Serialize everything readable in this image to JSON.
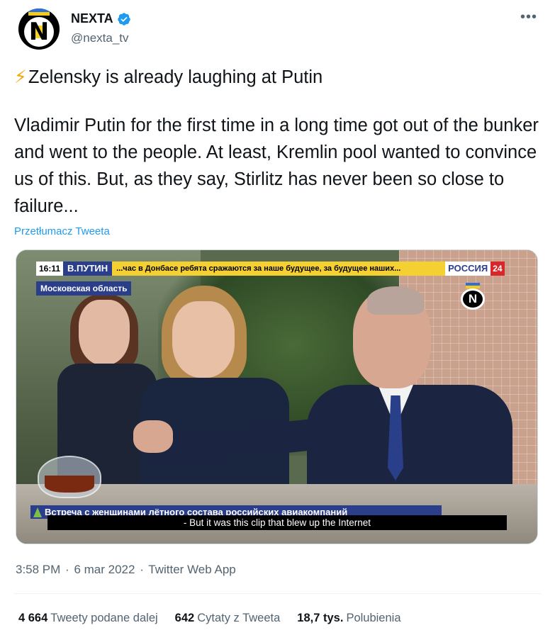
{
  "author": {
    "display_name": "NEXTA",
    "handle": "@nexta_tv",
    "avatar_letter": "N",
    "verified": true,
    "verified_color": "#1d9bf0"
  },
  "more_label": "•••",
  "tweet": {
    "headline_emoji": "⚡",
    "headline": "Zelensky is already laughing at Putin",
    "body": "Vladimir Putin for the first time in a long time got out of the bunker and went to the people.  At least, Kremlin pool wanted to convince us of this. But, as they say, Stirlitz has never been so close to failure...",
    "translate_link": "Przetłumacz Tweeta"
  },
  "media": {
    "ticker_time": "16:11",
    "ticker_name": "В.ПУТИН",
    "ticker_news": "...час в Донбасе ребята сражаются за наше будущее, за будущее наших...",
    "channel": "РОССИЯ",
    "channel_num": "24",
    "region": "Московская область",
    "watermark_letter": "N",
    "lower_third": "Встреча с женщинами лётного состава российских авиакомпаний",
    "subtitle": "- But it was this clip that blew up the Internet"
  },
  "meta": {
    "time": "3:58 PM",
    "separator": "·",
    "date": "6 mar 2022",
    "source": "Twitter Web App"
  },
  "stats": [
    {
      "value": "4 664",
      "label": "Tweety podane dalej"
    },
    {
      "value": "642",
      "label": "Cytaty z Tweeta"
    },
    {
      "value": "18,7 tys.",
      "label": "Polubienia"
    }
  ],
  "colors": {
    "text": "#0f1419",
    "secondary": "#536471",
    "link": "#1d9bf0",
    "rossiya_blue": "#2a3e8c",
    "ticker_yellow": "#f5d033",
    "rossiya_red": "#d8262b"
  }
}
